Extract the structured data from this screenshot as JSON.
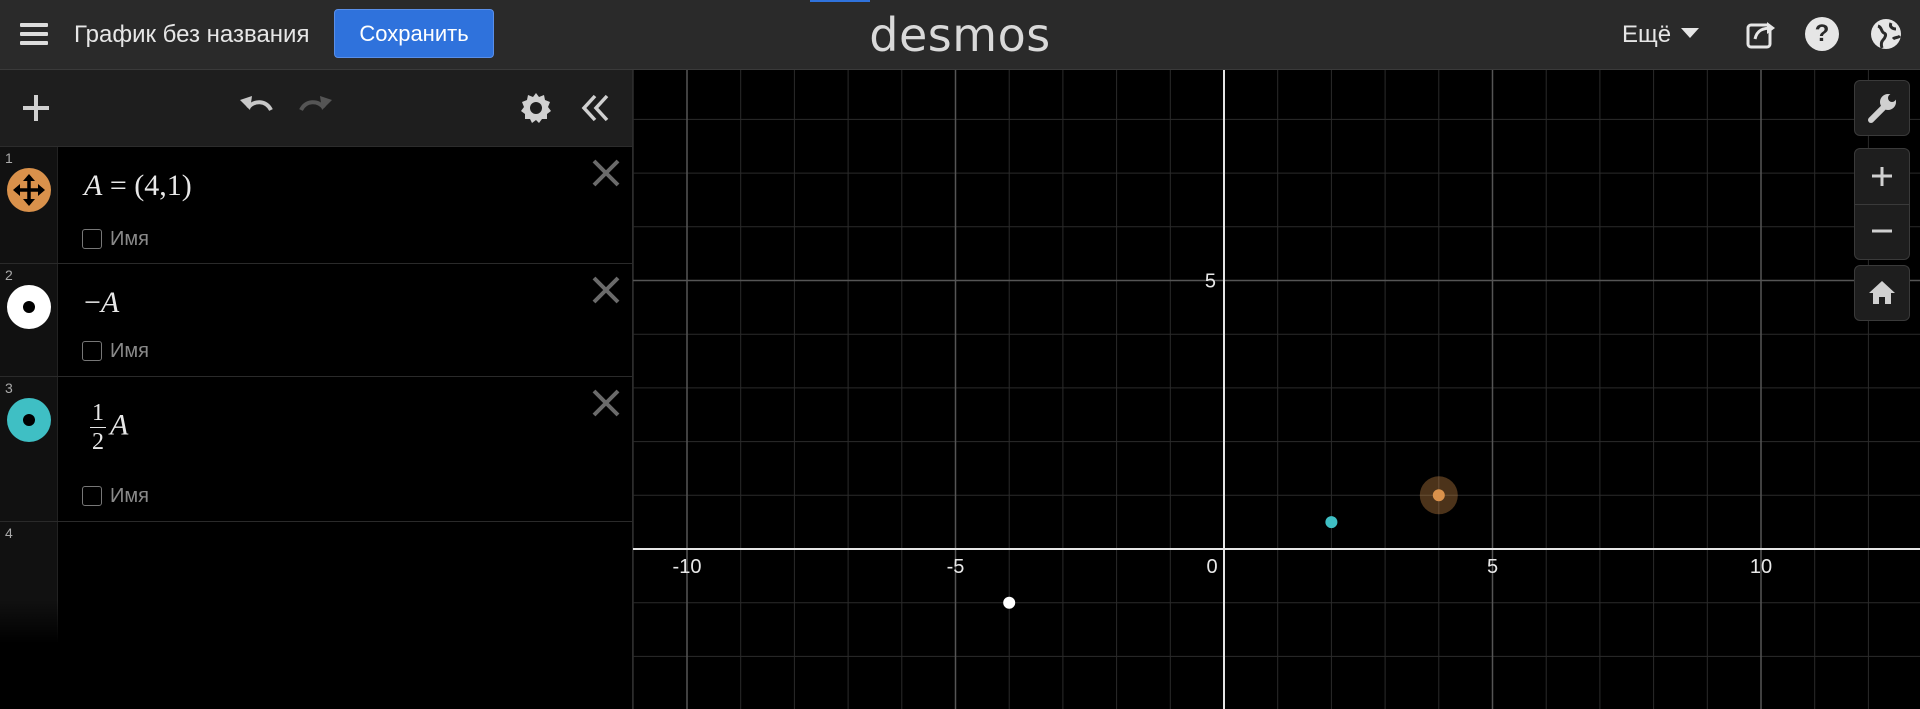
{
  "header": {
    "title": "График без названия",
    "save_label": "Сохранить",
    "logo": "desmos",
    "more_label": "Ещё"
  },
  "expressions": [
    {
      "num": "1",
      "icon": "move-point-icon",
      "color": "#d9914b",
      "label_text": "Имя"
    },
    {
      "num": "2",
      "icon": "point-icon",
      "color": "#ffffff",
      "label_text": "Имя"
    },
    {
      "num": "3",
      "icon": "point-icon",
      "color": "#3fbfc4",
      "label_text": "Имя"
    },
    {
      "num": "4"
    }
  ],
  "math": {
    "e1_lhs": "A",
    "e1_eq": " = ",
    "e1_rhs": "(4,1)",
    "e2_minus": "−",
    "e2_var": "A",
    "e3_num": "1",
    "e3_den": "2",
    "e3_var": "A"
  },
  "graph": {
    "x_ticks": [
      "-10",
      "-5",
      "0",
      "5",
      "10"
    ],
    "y_ticks": [
      "5"
    ],
    "points": [
      {
        "x": 4,
        "y": 1,
        "color": "#d9914b",
        "movable": true
      },
      {
        "x": -4,
        "y": -1,
        "color": "#ffffff"
      },
      {
        "x": 2,
        "y": 0.5,
        "color": "#3fbfc4"
      }
    ]
  },
  "colors": {
    "accent": "#2f72dc",
    "orange": "#d9914b",
    "teal": "#3fbfc4"
  }
}
